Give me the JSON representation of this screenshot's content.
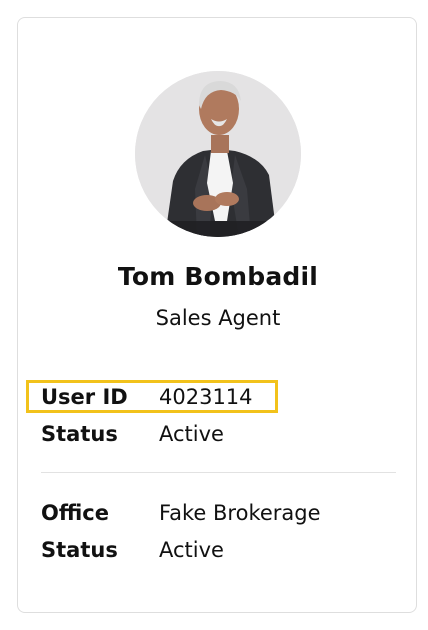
{
  "profile": {
    "name": "Tom Bombadil",
    "role": "Sales Agent"
  },
  "details_primary": [
    {
      "label": "User ID",
      "value": "4023114",
      "highlighted": true
    },
    {
      "label": "Status",
      "value": "Active"
    }
  ],
  "details_secondary": [
    {
      "label": "Office",
      "value": "Fake Brokerage"
    },
    {
      "label": "Status",
      "value": "Active"
    }
  ],
  "colors": {
    "highlight_border": "#f2c21b",
    "card_border": "#dedede",
    "divider": "#e2e2e2",
    "text": "#111111"
  }
}
